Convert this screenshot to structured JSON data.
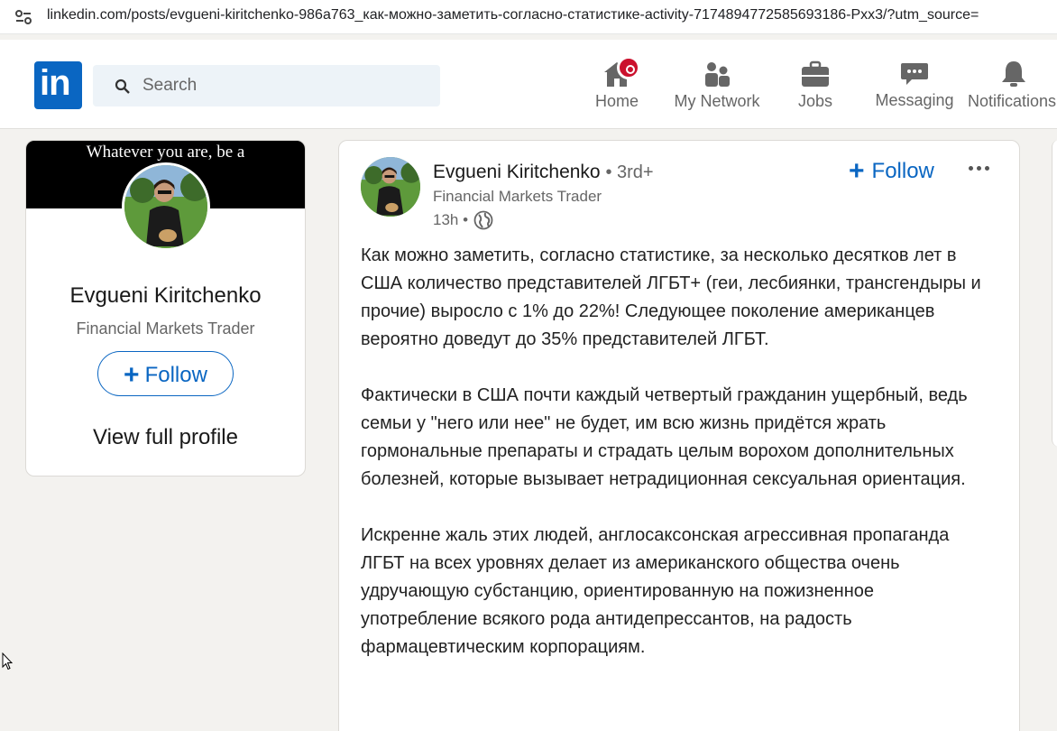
{
  "browser": {
    "url": "linkedin.com/posts/evgueni-kiritchenko-986a763_как-можно-заметить-согласно-статистике-activity-7174894772585693186-Pxx3/?utm_source="
  },
  "header": {
    "logo_text": "in",
    "search_placeholder": "Search",
    "nav": [
      {
        "label": "Home",
        "icon": "home-icon"
      },
      {
        "label": "My Network",
        "icon": "people-icon"
      },
      {
        "label": "Jobs",
        "icon": "briefcase-icon"
      },
      {
        "label": "Messaging",
        "icon": "chat-icon"
      },
      {
        "label": "Notifications",
        "icon": "bell-icon"
      }
    ]
  },
  "profile_card": {
    "cover_text": "Whatever you are, be a",
    "name": "Evgueni Kiritchenko",
    "title": "Financial Markets Trader",
    "follow_label": "Follow",
    "view_profile_label": "View full profile"
  },
  "post": {
    "author": "Evgueni Kiritchenko",
    "degree": "• 3rd+",
    "headline": "Financial Markets Trader",
    "time": "13h •",
    "follow_label": "Follow",
    "paragraphs": [
      "Как можно заметить, согласно статистике, за несколько десятков лет в США количество представителей ЛГБТ+ (геи, лесбиянки, трансгендыры и прочие) выросло с 1% до 22%! Следующее поколение американцев вероятно доведут до 35% представителей ЛГБТ.",
      "Фактически в США почти каждый четвертый гражданин ущербный, ведь семьи у \"него или нее\" не будет, им всю жизнь придётся жрать гормональные препараты и страдать целым ворохом дополнительных болезней, которые вызывает нетрадиционная сексуальная ориентация.",
      "Искренне жаль этих людей, англосаксонская агрессивная пропаганда ЛГБТ на всех уровнях делает из американского общества очень удручающую субстанцию, ориентированную на пожизненное употребление всякого рода антидепрессантов, на радость фармацевтическим корпорациям."
    ]
  },
  "colors": {
    "brand": "#0a66c2",
    "badge": "#cb112d",
    "background": "#f3f2ef"
  }
}
